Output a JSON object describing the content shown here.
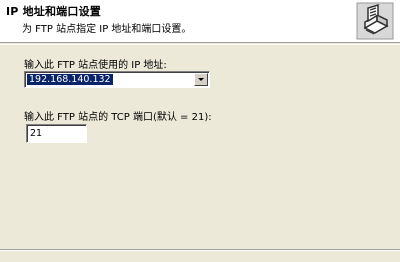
{
  "header": {
    "title": "IP 地址和端口设置",
    "subtitle": "为 FTP 站点指定 IP 地址和端口设置。",
    "icon": "printer-icon"
  },
  "ip_address": {
    "label": "输入此 FTP 站点使用的 IP 地址:",
    "value": "192.168.140.132"
  },
  "tcp_port": {
    "label": "输入此 FTP 站点的 TCP 端口(默认 = 21):",
    "value": "21"
  },
  "colors": {
    "background": "#ece9d8",
    "selection": "#0a246a"
  }
}
